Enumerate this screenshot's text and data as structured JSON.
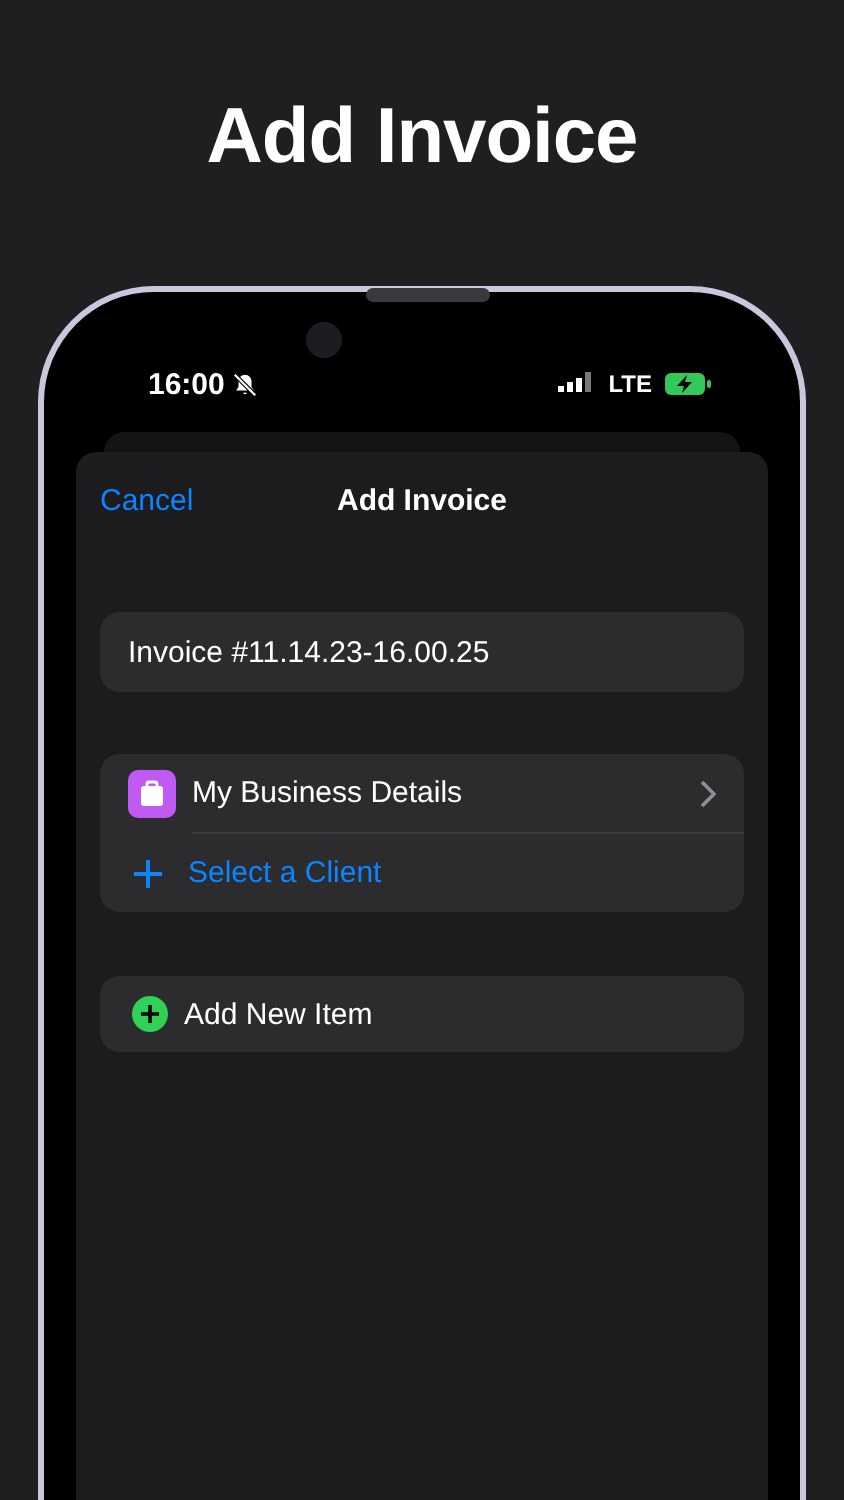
{
  "headline": "Add Invoice",
  "status_bar": {
    "time": "16:00",
    "network": "LTE"
  },
  "nav": {
    "cancel": "Cancel",
    "title": "Add Invoice"
  },
  "invoice_field": {
    "value": "Invoice #11.14.23-16.00.25"
  },
  "business_row": {
    "label": "My Business Details"
  },
  "client_row": {
    "label": "Select a Client"
  },
  "add_item": {
    "label": "Add New Item"
  }
}
